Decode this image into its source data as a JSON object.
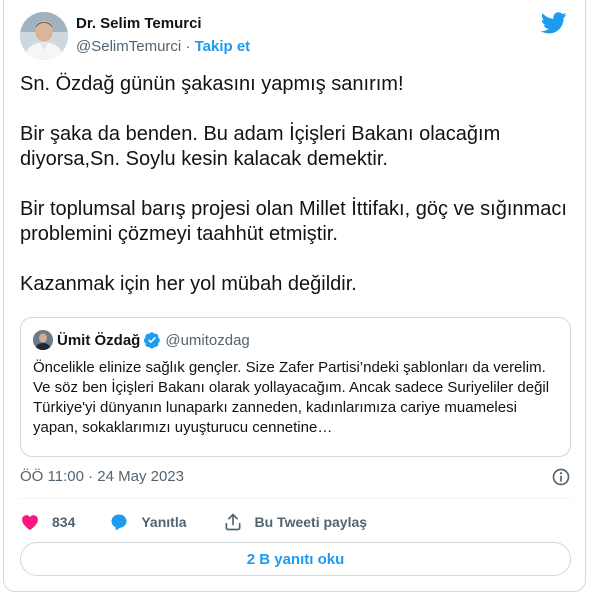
{
  "author": {
    "name": "Dr. Selim Temurci",
    "handle": "@SelimTemurci",
    "separator": "·",
    "follow_label": "Takip et"
  },
  "brand": {
    "logo_icon": "twitter-bird-icon",
    "accent_color": "#1d9bf0"
  },
  "tweet": {
    "paragraphs": [
      "Sn. Özdağ günün şakasını yapmış sanırım!",
      "Bir şaka da benden. Bu adam İçişleri Bakanı olacağım diyorsa,Sn. Soylu kesin kalacak demektir.",
      "Bir toplumsal barış projesi olan Millet İttifakı, göç ve sığınmacı problemini çözmeyi taahhüt etmiştir.",
      "Kazanmak için her yol mübah değildir."
    ]
  },
  "quoted_tweet": {
    "name": "Ümit Özdağ",
    "handle": "@umitozdag",
    "verified_icon": "verified-badge-icon",
    "text": "Öncelikle elinize sağlık gençler. Size Zafer Partisi’ndeki şablonları da verelim. Ve söz ben İçişleri Bakanı olarak yollayacağım. Ancak sadece Suriyeliler değil Türkiye'yi dünyanın lunaparkı zanneden, kadınlarımıza cariye muamelesi yapan, sokaklarımızı uyuşturucu cennetine…"
  },
  "meta": {
    "timestamp": "ÖÖ 11:00 · 24 May 2023",
    "info_icon": "info-icon"
  },
  "actions": {
    "like_count": "834",
    "like_icon": "heart-icon",
    "like_color": "#f91880",
    "reply_label": "Yanıtla",
    "reply_icon": "speech-bubble-icon",
    "share_label": "Bu Tweeti paylaş",
    "share_icon": "share-upload-icon"
  },
  "replies_button": {
    "label": "2 B yanıtı oku"
  }
}
